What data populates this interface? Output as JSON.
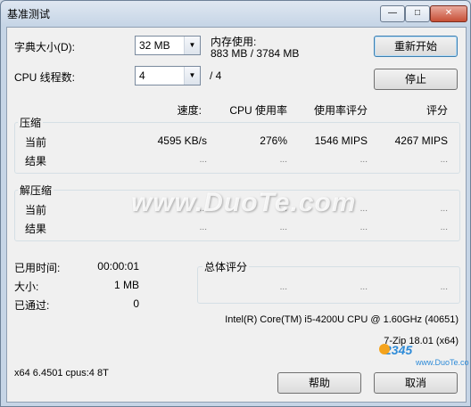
{
  "window": {
    "title": "基准测试",
    "controls": [
      "minimize-icon",
      "maximize-icon",
      "close-icon"
    ]
  },
  "dict": {
    "label": "字典大小(D):",
    "value": "32 MB"
  },
  "mem": {
    "label": "内存使用:",
    "value": "883 MB / 3784 MB"
  },
  "threads": {
    "label": "CPU 线程数:",
    "value": "4",
    "max": "/ 4"
  },
  "buttons": {
    "restart": "重新开始",
    "stop": "停止",
    "help": "帮助",
    "cancel": "取消"
  },
  "columns": {
    "speed": "速度:",
    "cpu": "CPU 使用率",
    "usage_rating": "使用率评分",
    "rating": "评分"
  },
  "compress": {
    "title": "压缩",
    "current": {
      "label": "当前",
      "speed": "4595 KB/s",
      "cpu": "276%",
      "usage": "1546 MIPS",
      "rating": "4267 MIPS"
    },
    "result": {
      "label": "结果",
      "speed": "...",
      "cpu": "...",
      "usage": "...",
      "rating": "..."
    }
  },
  "decompress": {
    "title": "解压缩",
    "current": {
      "label": "当前",
      "speed": "...",
      "cpu": "...",
      "usage": "...",
      "rating": "..."
    },
    "result": {
      "label": "结果",
      "speed": "...",
      "cpu": "...",
      "usage": "...",
      "rating": "..."
    }
  },
  "stats": {
    "elapsed_label": "已用时间:",
    "elapsed": "00:00:01",
    "size_label": "大小:",
    "size": "1 MB",
    "passed_label": "已通过:",
    "passed": "0"
  },
  "total": {
    "title": "总体评分",
    "a": "...",
    "b": "...",
    "c": "..."
  },
  "cpu_info": "Intel(R) Core(TM) i5-4200U CPU @ 1.60GHz (40651)",
  "version": "7-Zip 18.01 (x64)",
  "sys_info": "x64 6.4501 cpus:4 8T",
  "watermark": {
    "main": "www.DuoTe.com",
    "corner": "www.DuoTe.com"
  }
}
